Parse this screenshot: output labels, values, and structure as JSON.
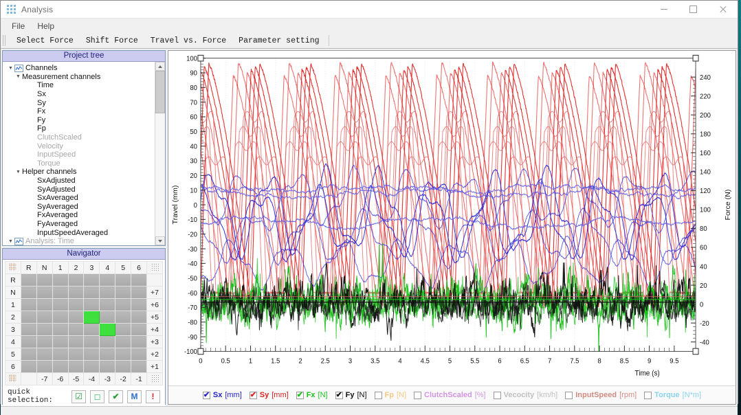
{
  "window": {
    "title": "Analysis",
    "icon": "app-grid-icon",
    "minimize": "–",
    "maximize": "□",
    "close": "✕"
  },
  "menubar": {
    "items": [
      "File",
      "Help"
    ]
  },
  "toolbar": {
    "items": [
      "Select Force",
      "Shift Force",
      "Travel vs. Force",
      "Parameter setting"
    ]
  },
  "project_tree": {
    "title": "Project tree",
    "nodes": [
      {
        "label": "Channels",
        "depth": 0,
        "twisty": "▼",
        "icon": "chart-icon",
        "dim": false
      },
      {
        "label": "Measurement channels",
        "depth": 1,
        "twisty": "▼",
        "icon": "",
        "dim": false
      },
      {
        "label": "Time",
        "depth": 3,
        "twisty": "",
        "icon": "",
        "dim": false
      },
      {
        "label": "Sx",
        "depth": 3,
        "twisty": "",
        "icon": "",
        "dim": false
      },
      {
        "label": "Sy",
        "depth": 3,
        "twisty": "",
        "icon": "",
        "dim": false
      },
      {
        "label": "Fx",
        "depth": 3,
        "twisty": "",
        "icon": "",
        "dim": false
      },
      {
        "label": "Fy",
        "depth": 3,
        "twisty": "",
        "icon": "",
        "dim": false
      },
      {
        "label": "Fp",
        "depth": 3,
        "twisty": "",
        "icon": "",
        "dim": false
      },
      {
        "label": "ClutchScaled",
        "depth": 3,
        "twisty": "",
        "icon": "",
        "dim": true
      },
      {
        "label": "Velocity",
        "depth": 3,
        "twisty": "",
        "icon": "",
        "dim": true
      },
      {
        "label": "InputSpeed",
        "depth": 3,
        "twisty": "",
        "icon": "",
        "dim": true
      },
      {
        "label": "Torque",
        "depth": 3,
        "twisty": "",
        "icon": "",
        "dim": true
      },
      {
        "label": "Helper channels",
        "depth": 1,
        "twisty": "▼",
        "icon": "",
        "dim": false
      },
      {
        "label": "SxAdjusted",
        "depth": 3,
        "twisty": "",
        "icon": "",
        "dim": false
      },
      {
        "label": "SyAdjusted",
        "depth": 3,
        "twisty": "",
        "icon": "",
        "dim": false
      },
      {
        "label": "SxAveraged",
        "depth": 3,
        "twisty": "",
        "icon": "",
        "dim": false
      },
      {
        "label": "SyAveraged",
        "depth": 3,
        "twisty": "",
        "icon": "",
        "dim": false
      },
      {
        "label": "FxAveraged",
        "depth": 3,
        "twisty": "",
        "icon": "",
        "dim": false
      },
      {
        "label": "FyAveraged",
        "depth": 3,
        "twisty": "",
        "icon": "",
        "dim": false
      },
      {
        "label": "InputSpeedAveraged",
        "depth": 3,
        "twisty": "",
        "icon": "",
        "dim": false
      },
      {
        "label": "Analysis: Time",
        "depth": 0,
        "twisty": "▼",
        "icon": "chart-icon",
        "dim": true
      }
    ]
  },
  "navigator": {
    "title": "Navigator",
    "col_headers": [
      "R",
      "N",
      "1",
      "2",
      "3",
      "4",
      "5",
      "6"
    ],
    "row_headers": [
      "R",
      "N",
      "1",
      "2",
      "3",
      "4",
      "5",
      "6"
    ],
    "right_labels": [
      "",
      "+7",
      "+6",
      "+5",
      "+4",
      "+3",
      "+2",
      "+1"
    ],
    "bottom_labels": [
      "",
      "-7",
      "-6",
      "-5",
      "-4",
      "-3",
      "-2",
      "-1"
    ],
    "selected_cells": [
      {
        "row": 3,
        "col": 4
      },
      {
        "row": 4,
        "col": 5
      }
    ],
    "selected_color": "#3ee03e",
    "quick_selection": {
      "label": "quick selection:",
      "buttons": [
        {
          "name": "select-all-button",
          "glyph": "☑",
          "color": "#1f9d3f"
        },
        {
          "name": "select-none-button",
          "glyph": "◻",
          "color": "#35c06a"
        },
        {
          "name": "confirm-button",
          "glyph": "✔",
          "color": "#2a9c3a"
        },
        {
          "name": "measurement-button",
          "glyph": "M",
          "color": "#2f6fd0"
        },
        {
          "name": "alert-button",
          "glyph": "!",
          "color": "#d02020"
        }
      ]
    }
  },
  "chart_data": {
    "type": "line",
    "title": "",
    "xlabel": "Time (s)",
    "ylabel": "Travel (mm)",
    "y2label": "Force (N)",
    "xlim": [
      0,
      9.93
    ],
    "ylim": [
      -100,
      100
    ],
    "y2lim": [
      -50,
      260
    ],
    "xticks": [
      0,
      0.5,
      1,
      1.5,
      2,
      2.5,
      3,
      3.5,
      4,
      4.5,
      5,
      5.5,
      6,
      6.5,
      7,
      7.5,
      8,
      8.5,
      9,
      9.5
    ],
    "xticklabels": [
      "0",
      "0.5",
      "1",
      "1.5",
      "2",
      "2.5",
      "3",
      "3.5",
      "4",
      "4.5",
      "5",
      "5.5",
      "6",
      "6.5",
      "7",
      "7.5",
      "8",
      "8.5",
      "9",
      "9.5"
    ],
    "yticks": [
      -100,
      -90,
      -80,
      -70,
      -60,
      -50,
      -40,
      -30,
      -20,
      -10,
      0,
      10,
      20,
      30,
      40,
      50,
      60,
      70,
      80,
      90,
      100
    ],
    "y2ticks": [
      -40,
      -20,
      0,
      20,
      40,
      60,
      80,
      100,
      120,
      140,
      160,
      180,
      200,
      220,
      240
    ],
    "grid": true,
    "legend_position": "bottom",
    "series": [
      {
        "name": "Sx",
        "unit": "[mm]",
        "color": "#2020d0",
        "visible": true,
        "axis": "left"
      },
      {
        "name": "Sy",
        "unit": "[mm]",
        "color": "#e02020",
        "visible": true,
        "axis": "left"
      },
      {
        "name": "Fx",
        "unit": "[N]",
        "color": "#18c018",
        "visible": true,
        "axis": "right"
      },
      {
        "name": "Fy",
        "unit": "[N]",
        "color": "#101010",
        "visible": true,
        "axis": "right"
      },
      {
        "name": "Fp",
        "unit": "[N]",
        "color": "#f0a020",
        "visible": false,
        "axis": "right"
      },
      {
        "name": "ClutchScaled",
        "unit": "[%]",
        "color": "#b040d0",
        "visible": false,
        "axis": "right"
      },
      {
        "name": "Vecocity",
        "unit": "[km/h]",
        "color": "#909090",
        "visible": false,
        "axis": "right"
      },
      {
        "name": "InputSpeed",
        "unit": "[rpm]",
        "color": "#b03020",
        "visible": false,
        "axis": "right"
      },
      {
        "name": "Torque",
        "unit": "[N*m]",
        "color": "#30b0e0",
        "visible": false,
        "axis": "right"
      }
    ]
  },
  "statusbar": {
    "text": ""
  }
}
